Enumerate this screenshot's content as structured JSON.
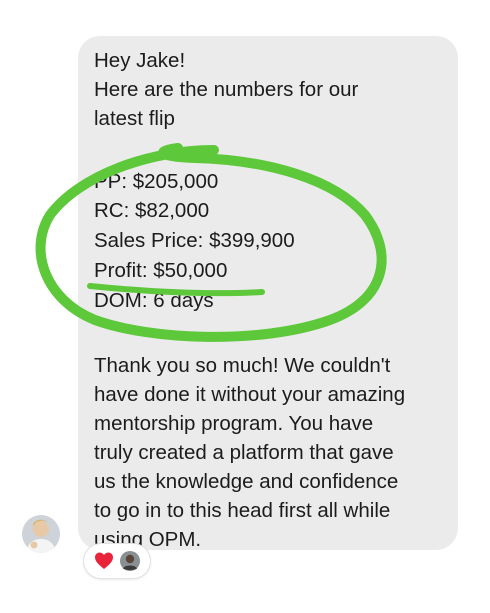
{
  "message": {
    "greeting": "Hey Jake!",
    "intro_line1": "Here are the numbers for our",
    "intro_line2": "latest flip",
    "stats": [
      {
        "label": "PP:",
        "value": "$205,000"
      },
      {
        "label": "RC:",
        "value": "$82,000"
      },
      {
        "label": "Sales Price:",
        "value": "$399,900"
      },
      {
        "label": "Profit:",
        "value": "$50,000"
      },
      {
        "label": "DOM:",
        "value": "6 days"
      }
    ],
    "thanks_lines": [
      "Thank you so much! We couldn't",
      "have done it without your amazing",
      "mentorship program. You have",
      "truly created a platform that gave",
      "us the knowledge and confidence",
      "to go in to this head first all while",
      "using OPM."
    ]
  },
  "reactions": [
    {
      "icon": "heart-icon",
      "color": "#e8233a"
    },
    {
      "icon": "user-avatar-icon",
      "color": "#6b5a4c"
    }
  ],
  "colors": {
    "bubble": "#ebebeb",
    "text": "#1c1c1c",
    "highlight_marker": "#5cc83a"
  }
}
